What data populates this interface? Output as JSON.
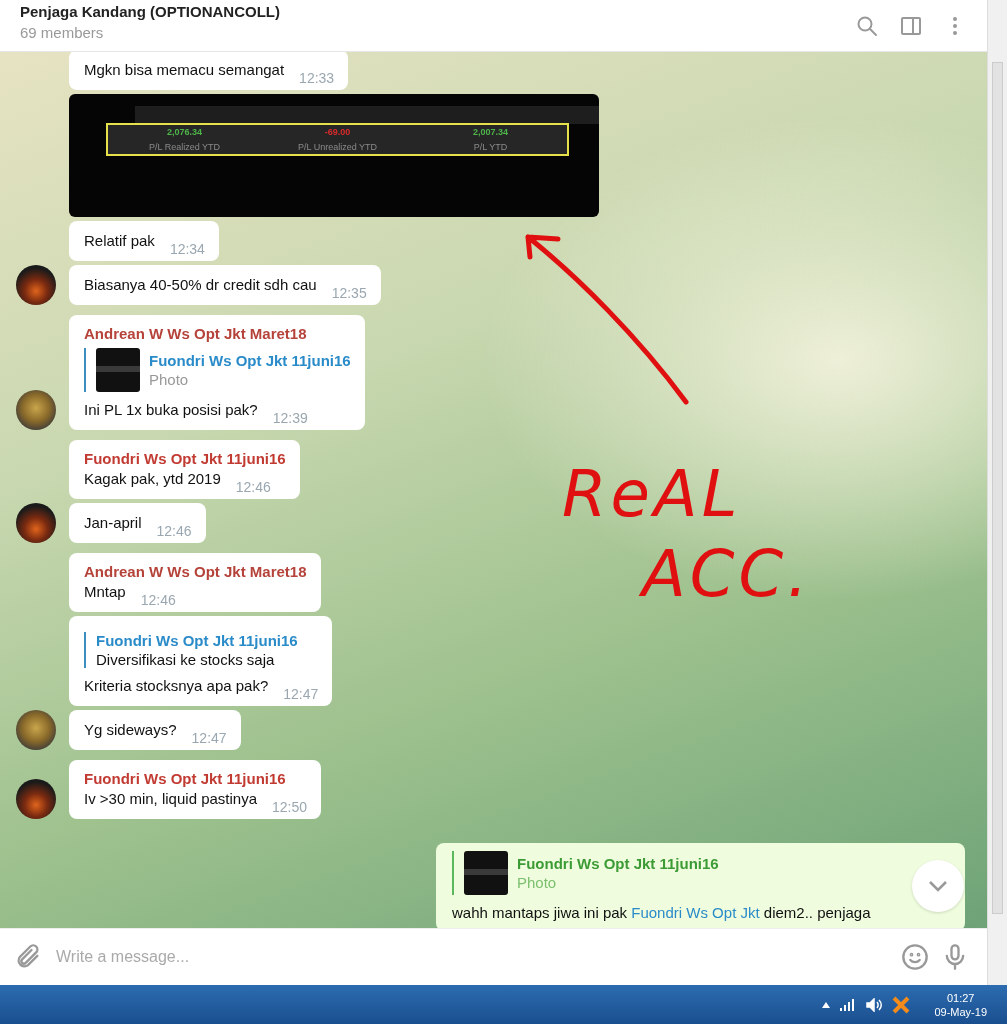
{
  "header": {
    "title": "Penjaga Kandang (OPTIONANCOLL)",
    "subtitle": "69 members"
  },
  "messages": [
    {
      "kind": "text",
      "text": "Mgkn bisa memacu semangat",
      "time": "12:33"
    },
    {
      "kind": "photo",
      "stats": [
        {
          "value": "2,076.34",
          "label": "P/L Realized YTD",
          "kind": "positive"
        },
        {
          "value": "-69.00",
          "label": "P/L Unrealized YTD",
          "kind": "negative"
        },
        {
          "value": "2,007.34",
          "label": "P/L YTD",
          "kind": "positive"
        }
      ]
    },
    {
      "kind": "text",
      "text": "Relatif pak",
      "time": "12:34"
    },
    {
      "kind": "text",
      "avatar": {
        "kind": "fire"
      },
      "text": "Biasanya 40-50% dr credit sdh cau",
      "time": "12:35"
    },
    {
      "kind": "text",
      "avatar": {
        "kind": "bear"
      },
      "sender": "Andrean W Ws Opt Jkt Maret18",
      "color": "#b5433a",
      "reply": {
        "name": "Fuondri Ws Opt Jkt 11juni16",
        "text": "Photo",
        "thumb": true
      },
      "text": "Ini PL 1x buka posisi pak?",
      "time": "12:39"
    },
    {
      "kind": "text",
      "sender": "Fuondri Ws Opt Jkt 11juni16",
      "color": "#c23b33",
      "text": "Kagak pak, ytd 2019",
      "time": "12:46"
    },
    {
      "kind": "text",
      "avatar": {
        "kind": "fire"
      },
      "text": "Jan-april",
      "time": "12:46"
    },
    {
      "kind": "text",
      "sender": "Andrean W Ws Opt Jkt Maret18",
      "color": "#b5433a",
      "text": "Mntap",
      "time": "12:46"
    },
    {
      "kind": "text",
      "reply": {
        "name": "Fuondri Ws Opt Jkt 11juni16",
        "text": "Diversifikasi ke stocks saja",
        "thumb": false
      },
      "text": "Kriteria stocksnya apa pak?",
      "time": "12:47"
    },
    {
      "kind": "text",
      "avatar": {
        "kind": "bear"
      },
      "text": "Yg sideways?",
      "time": "12:47"
    },
    {
      "kind": "text",
      "avatar": {
        "kind": "fire"
      },
      "sender": "Fuondri Ws Opt Jkt 11juni16",
      "color": "#c23b33",
      "text": "Iv >30 min, liquid pastinya",
      "time": "12:50"
    }
  ],
  "outgoing": {
    "reply": {
      "name": "Fuondri Ws Opt Jkt 11juni16",
      "text": "Photo"
    },
    "text_before": "wahh mantaps jiwa ini pak",
    "mention": "Fuondri Ws Opt Jkt",
    "text_after": "diem2.. penjaga"
  },
  "annotation": {
    "line_1": "ReAL",
    "line_2": "ACC."
  },
  "composer": {
    "placeholder": "Write a message..."
  },
  "taskbar": {
    "time": "01:27",
    "date": "09-May-19"
  }
}
